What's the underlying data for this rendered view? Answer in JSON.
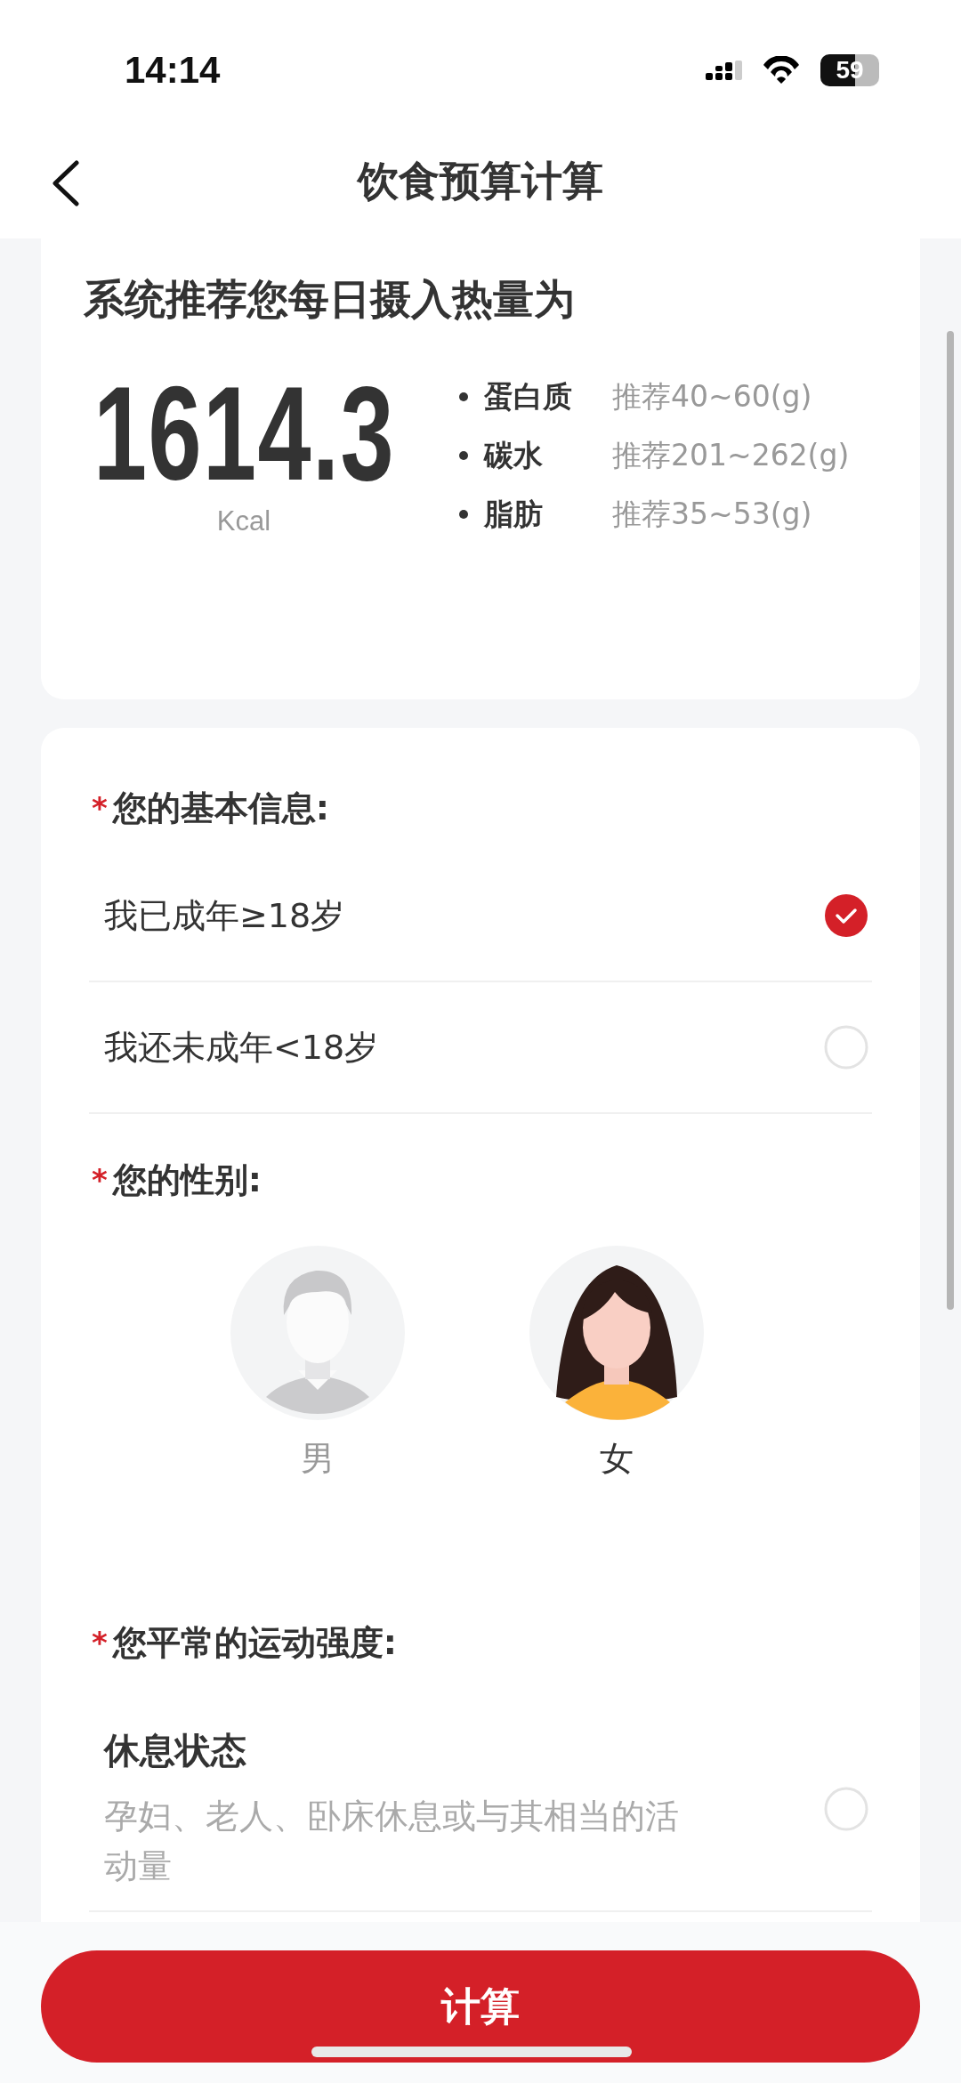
{
  "status_bar": {
    "time": "14:14",
    "battery": "59"
  },
  "header": {
    "title": "饮食预算计算"
  },
  "summary": {
    "title": "系统推荐您每日摄入热量为",
    "calories": "1614.3",
    "unit": "Kcal",
    "nutrients": [
      {
        "name": "蛋白质",
        "recommendation": "推荐40~60(g)"
      },
      {
        "name": "碳水",
        "recommendation": "推荐201~262(g)"
      },
      {
        "name": "脂肪",
        "recommendation": "推荐35~53(g)"
      }
    ]
  },
  "form": {
    "sections": [
      {
        "kind": "options",
        "required_mark": "*",
        "label": "您的基本信息:",
        "options": [
          {
            "label": "我已成年≥18岁",
            "selected": true
          },
          {
            "label": "我还未成年<18岁",
            "selected": false
          }
        ]
      },
      {
        "kind": "gender",
        "required_mark": "*",
        "label": "您的性别:",
        "options": [
          {
            "kind": "man",
            "label": "男",
            "selected": false
          },
          {
            "kind": "woman",
            "label": "女",
            "selected": true
          }
        ]
      },
      {
        "kind": "options",
        "required_mark": "*",
        "label": "您平常的运动强度:",
        "options": [
          {
            "label": "休息状态",
            "description": "孕妇、老人、卧床休息或与其相当的活动量",
            "selected": false
          }
        ]
      }
    ]
  },
  "submit": {
    "label": "计算"
  }
}
